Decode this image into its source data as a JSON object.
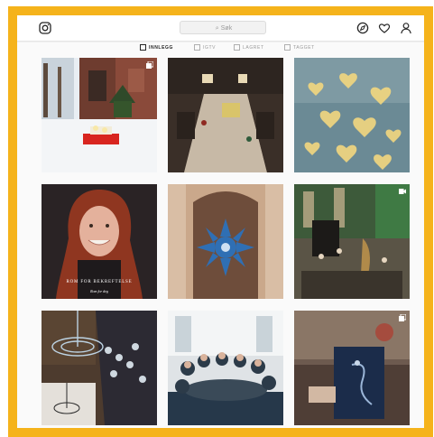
{
  "topbar": {
    "logo_icon": "instagram-icon",
    "search_placeholder": "Søk",
    "search_icon": "search-icon",
    "nav_icons": [
      "compass-icon",
      "heart-icon",
      "user-icon"
    ]
  },
  "tabs": [
    {
      "label": "INNLEGG",
      "icon": "grid-icon",
      "active": true
    },
    {
      "label": "IGTV",
      "icon": "tv-icon",
      "active": false
    },
    {
      "label": "LAGRET",
      "icon": "bookmark-icon",
      "active": false
    },
    {
      "label": "TAGGET",
      "icon": "tag-icon",
      "active": false
    }
  ],
  "posts": [
    {
      "description": "snowy church entrance with lanterns",
      "marker": "carousel-icon"
    },
    {
      "description": "church interior aerial view",
      "marker": ""
    },
    {
      "description": "golden bokeh hearts",
      "marker": ""
    },
    {
      "description": "smiling woman portrait",
      "marker": "",
      "caption_title": "ROM FOR BEKREFTELSE",
      "caption_sub": "Rom for deg"
    },
    {
      "description": "blue cross ornament on wooden door",
      "marker": ""
    },
    {
      "description": "concert in church with harp",
      "marker": "video-icon"
    },
    {
      "description": "chandelier and crowd",
      "marker": ""
    },
    {
      "description": "people gathered at a table",
      "marker": ""
    },
    {
      "description": "book held in hand",
      "marker": "carousel-icon"
    }
  ],
  "colors": {
    "frame": "#f5b31b",
    "page_bg": "#fafafa",
    "text_dark": "#262626",
    "text_muted": "#9a9a9a"
  }
}
